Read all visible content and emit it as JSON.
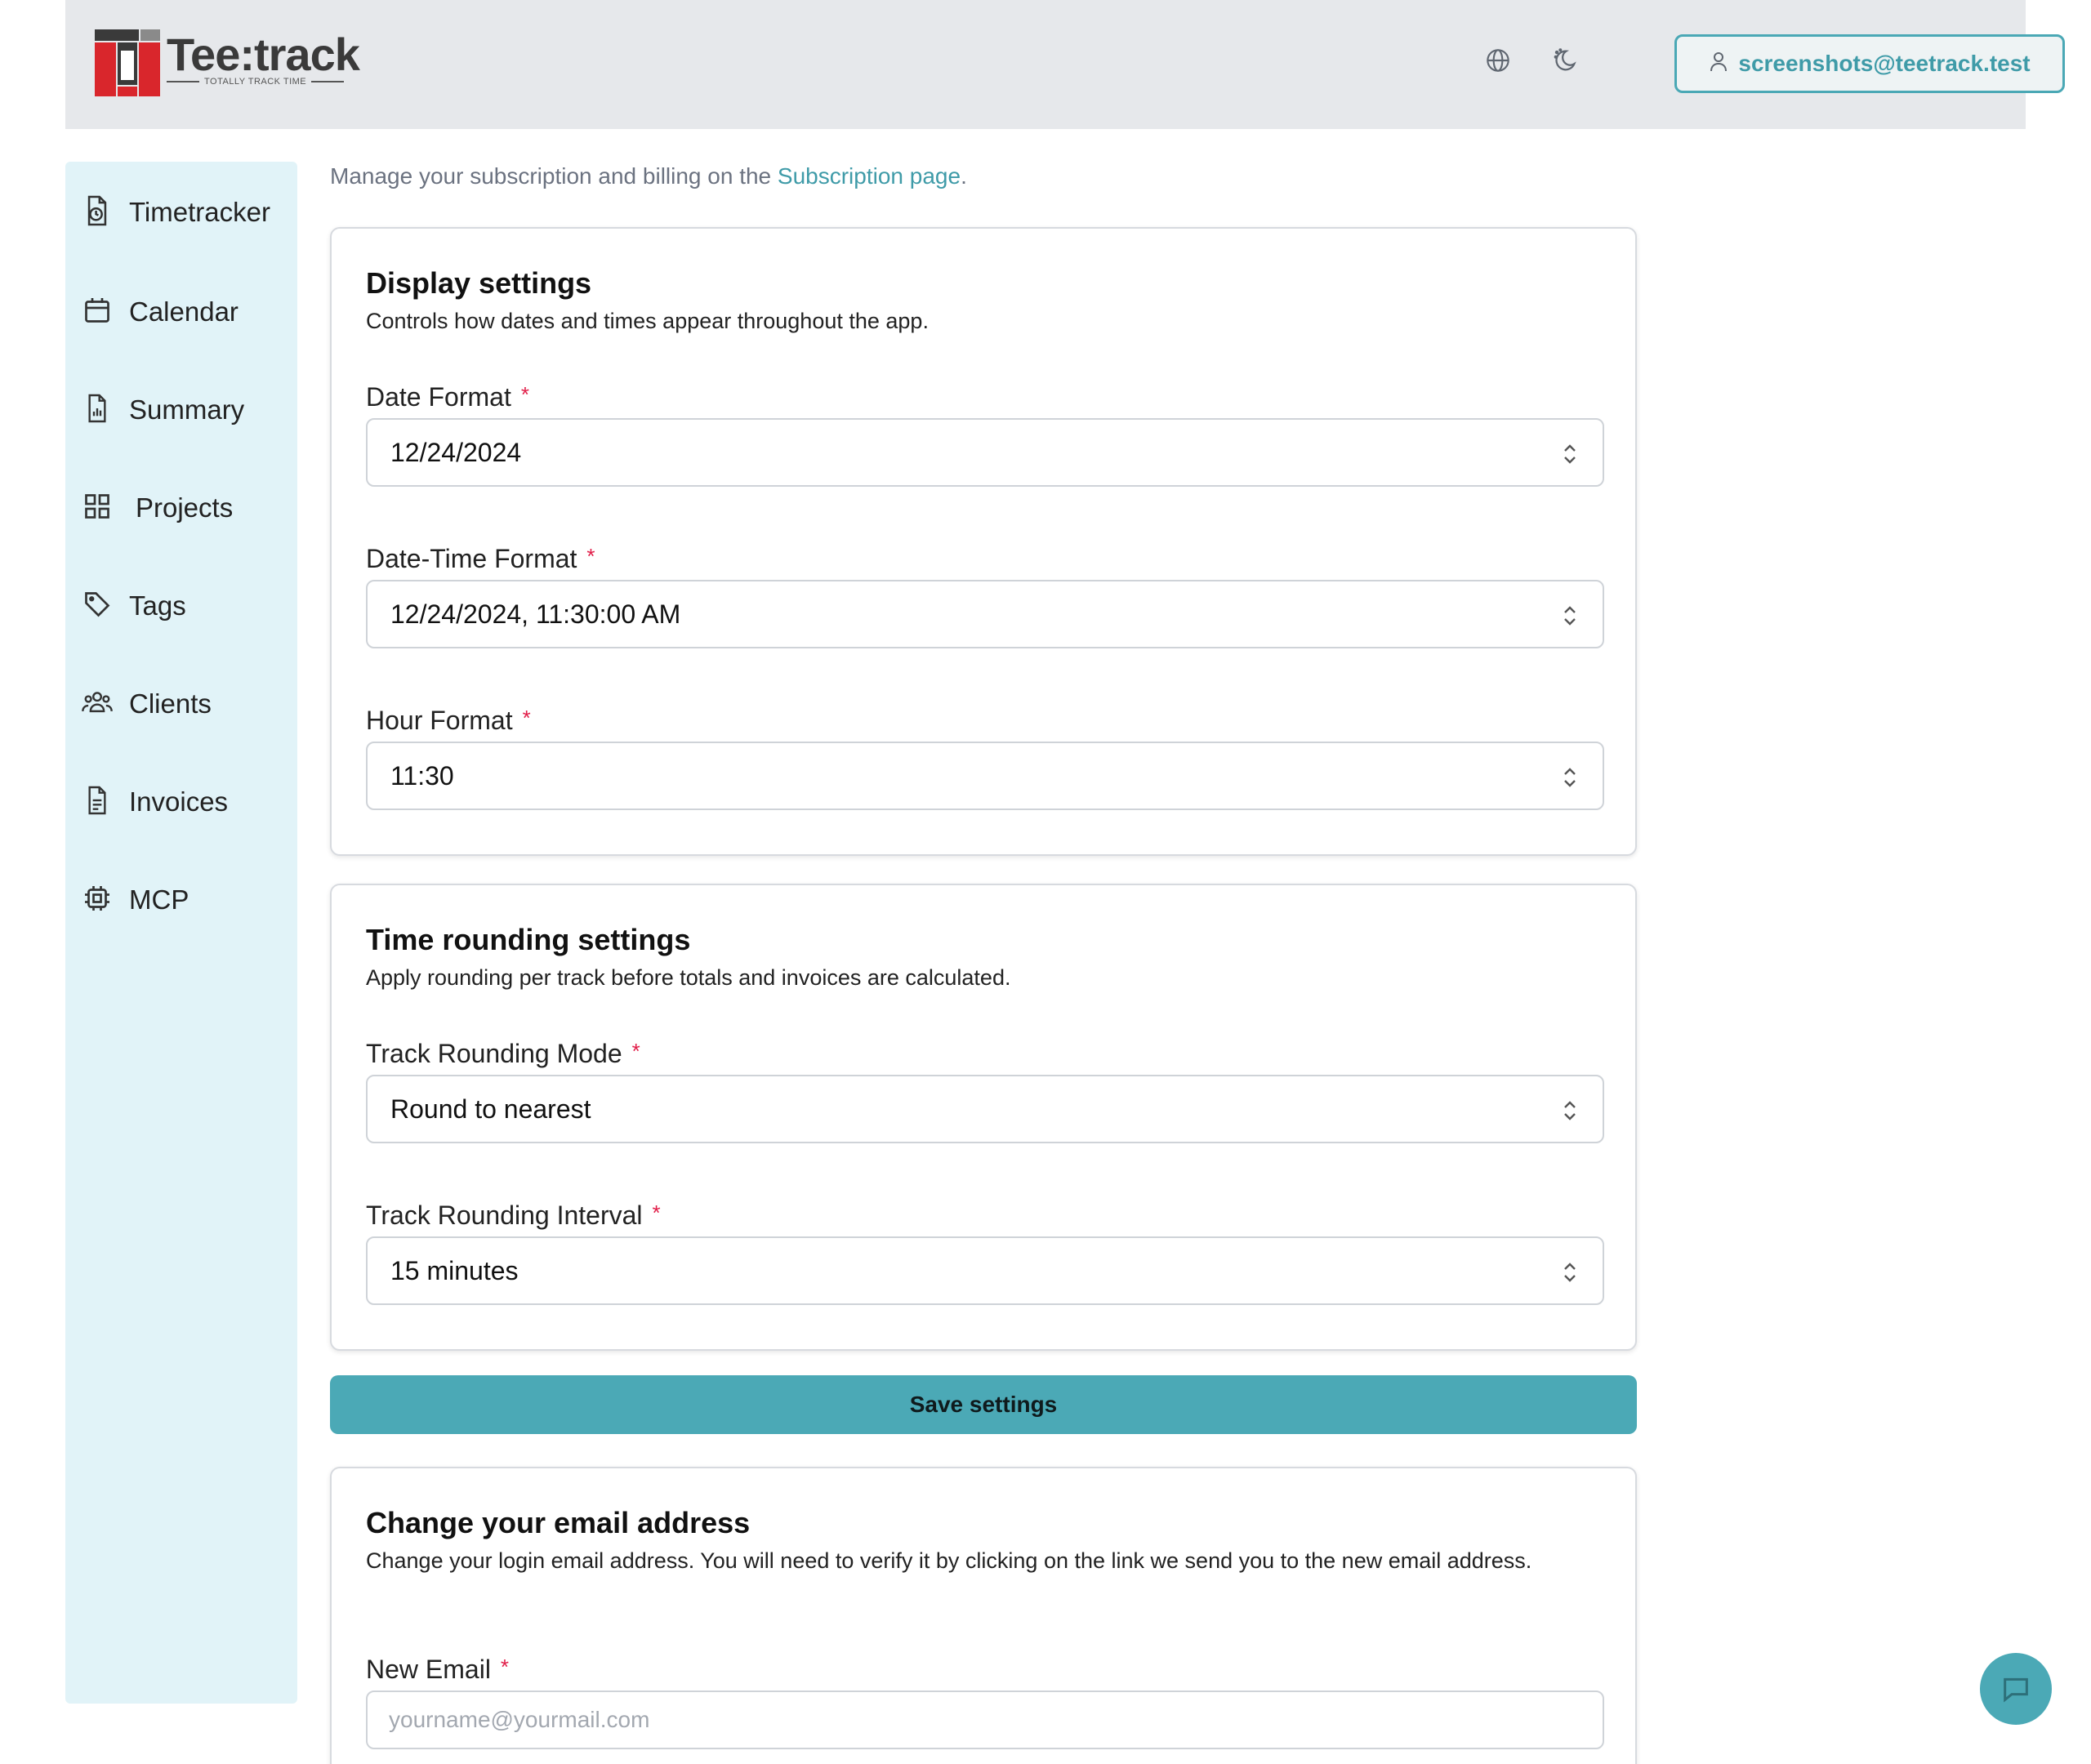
{
  "header": {
    "logo_word": "Tee:track",
    "logo_tagline": "TOTALLY TRACK TIME",
    "user_email": "screenshots@teetrack.test",
    "icons": [
      "globe-icon",
      "theme-toggle-icon",
      "user-icon"
    ]
  },
  "sidebar": {
    "items": [
      {
        "label": "Timetracker",
        "icon": "timetracker-icon"
      },
      {
        "label": "Calendar",
        "icon": "calendar-icon"
      },
      {
        "label": "Summary",
        "icon": "summary-icon"
      },
      {
        "label": "Projects",
        "icon": "projects-grid-icon"
      },
      {
        "label": "Tags",
        "icon": "tag-icon"
      },
      {
        "label": "Clients",
        "icon": "clients-icon"
      },
      {
        "label": "Invoices",
        "icon": "invoice-icon"
      },
      {
        "label": "MCP",
        "icon": "chip-icon"
      }
    ]
  },
  "intro": {
    "text": "Manage your subscription and billing on the ",
    "link": "Subscription page",
    "suffix": "."
  },
  "display_settings": {
    "title": "Display settings",
    "description": "Controls how dates and times appear throughout the app.",
    "date_format": {
      "label": "Date Format",
      "value": "12/24/2024"
    },
    "datetime_format": {
      "label": "Date-Time Format",
      "value": "12/24/2024, 11:30:00 AM"
    },
    "hour_format": {
      "label": "Hour Format",
      "value": "11:30"
    }
  },
  "rounding_settings": {
    "title": "Time rounding settings",
    "description": "Apply rounding per track before totals and invoices are calculated.",
    "mode": {
      "label": "Track Rounding Mode",
      "value": "Round to nearest"
    },
    "interval": {
      "label": "Track Rounding Interval",
      "value": "15 minutes"
    }
  },
  "save_label": "Save settings",
  "email_change": {
    "title": "Change your email address",
    "description": "Change your login email address. You will need to verify it by clicking on the link we send you to the new email address.",
    "new_email": {
      "label": "New Email",
      "placeholder": "yourname@yourmail.com"
    }
  },
  "required_marker": "*",
  "colors": {
    "accent": "#4ba9b6",
    "sidebar_bg": "#e1f3f8",
    "header_bg": "#e6e8eb",
    "required": "#e11d48",
    "logo_red": "#d9262c"
  }
}
